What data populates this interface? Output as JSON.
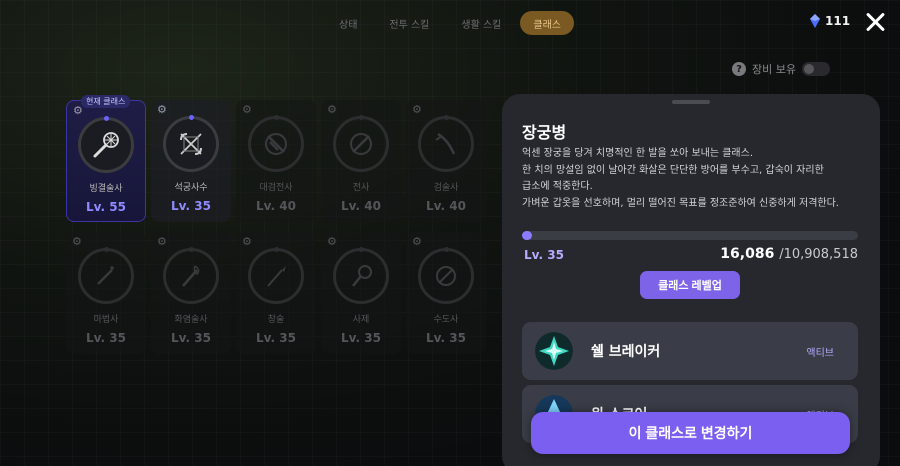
{
  "tabs": [
    {
      "label": "상태",
      "active": false
    },
    {
      "label": "전투 스킬",
      "active": false
    },
    {
      "label": "생활 스킬",
      "active": false
    },
    {
      "label": "클래스",
      "active": true
    }
  ],
  "currency": {
    "amount": "111",
    "icon": "gem-icon"
  },
  "equip_toggle": {
    "label": "장비 보유",
    "on": false
  },
  "classes": [
    {
      "name": "빙결술사",
      "level": "Lv. 55",
      "current": true,
      "current_label": "현재 클래스"
    },
    {
      "name": "석궁사수",
      "level": "Lv. 35",
      "selected": true
    },
    {
      "name": "대검전사",
      "level": "Lv. 40"
    },
    {
      "name": "전사",
      "level": "Lv. 40"
    },
    {
      "name": "검술사",
      "level": "Lv. 40"
    },
    {
      "name": "마법사",
      "level": "Lv. 35"
    },
    {
      "name": "화염술사",
      "level": "Lv. 35"
    },
    {
      "name": "창술",
      "level": "Lv. 35"
    },
    {
      "name": "사제",
      "level": "Lv. 35"
    },
    {
      "name": "수도사",
      "level": "Lv. 35"
    }
  ],
  "detail": {
    "title": "장궁병",
    "description": [
      "억센 장궁을 당겨 치명적인 한 발을 쏘아 보내는 클래스.",
      "한 치의 망설임 없이 날아간 화살은 단단한 방어를 부수고, 갑숙이 자리한",
      "급소에 적중한다.",
      "가벼운 갑옷을 선호하며, 멀리 떨어진 목표를 정조준하여 신중하게 저격한다."
    ],
    "level": "Lv. 35",
    "exp_current": "16,086",
    "exp_max": "/10,908,518",
    "exp_fraction": 0.0015,
    "levelup_label": "클래스 레벨업",
    "skills": [
      {
        "name": "쉘 브레이커",
        "type": "액티브"
      },
      {
        "name": "윈 스코어",
        "type": "액티브"
      }
    ],
    "change_label": "이 클래스로 변경하기"
  }
}
